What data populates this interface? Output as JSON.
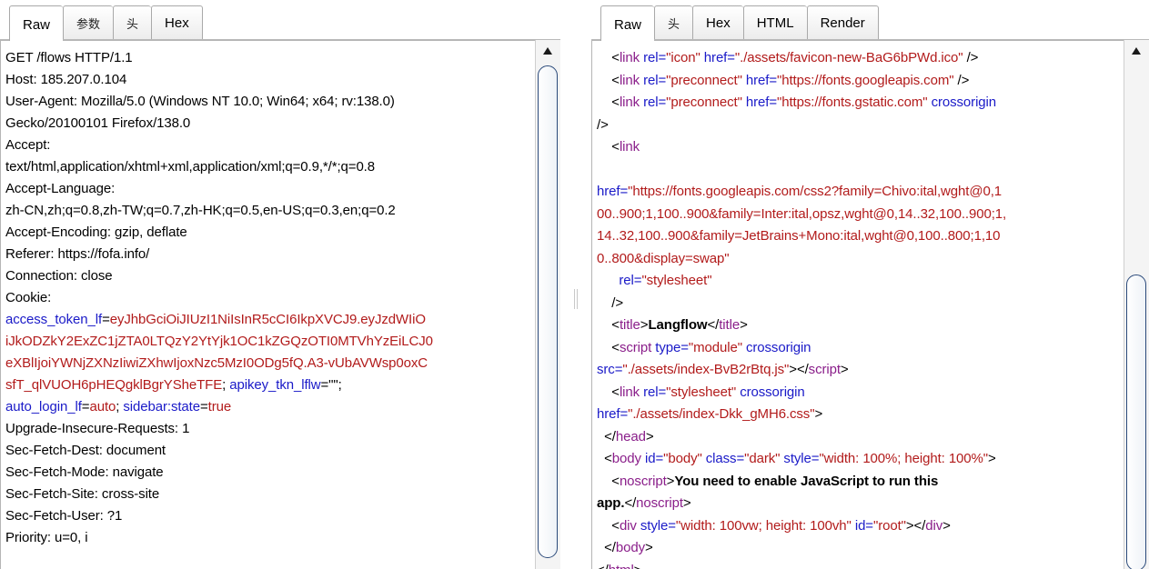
{
  "request": {
    "tabs": [
      "Raw",
      "参数",
      "头",
      "Hex"
    ],
    "lines": [
      [
        [
          "GET /flows HTTP/1.1",
          "p"
        ]
      ],
      [
        [
          "Host: 185.207.0.104",
          "p"
        ]
      ],
      [
        [
          "User-Agent: Mozilla/5.0 (Windows NT 10.0; Win64; x64; rv:138.0)",
          "p"
        ]
      ],
      [
        [
          "Gecko/20100101 Firefox/138.0",
          "p"
        ]
      ],
      [
        [
          "Accept:",
          "p"
        ]
      ],
      [
        [
          "text/html,application/xhtml+xml,application/xml;q=0.9,*/*;q=0.8",
          "p"
        ]
      ],
      [
        [
          "Accept-Language:",
          "p"
        ]
      ],
      [
        [
          "zh-CN,zh;q=0.8,zh-TW;q=0.7,zh-HK;q=0.5,en-US;q=0.3,en;q=0.2",
          "p"
        ]
      ],
      [
        [
          "Accept-Encoding: gzip, deflate",
          "p"
        ]
      ],
      [
        [
          "Referer: https://fofa.info/",
          "p"
        ]
      ],
      [
        [
          "Connection: close",
          "p"
        ]
      ],
      [
        [
          "Cookie:",
          "p"
        ]
      ],
      [
        [
          "access_token_lf",
          "k"
        ],
        [
          "=",
          "p"
        ],
        [
          "eyJhbGciOiJIUzI1NiIsInR5cCI6IkpXVCJ9.eyJzdWIiO",
          "v"
        ]
      ],
      [
        [
          "iJkODZkY2ExZC1jZTA0LTQzY2YtYjk1OC1kZGQzOTI0MTVhYzEiLCJ0",
          "v"
        ]
      ],
      [
        [
          "eXBlIjoiYWNjZXNzIiwiZXhwIjoxNzc5MzI0ODg5fQ.A3-vUbAVWsp0oxC",
          "v"
        ]
      ],
      [
        [
          "sfT_qlVUOH6pHEQgklBgrYSheTFE",
          "v"
        ],
        [
          ";",
          "p"
        ],
        [
          " apikey_tkn_lflw",
          "k"
        ],
        [
          "=\"\";",
          "p"
        ]
      ],
      [
        [
          "auto_login_lf",
          "k"
        ],
        [
          "=",
          "p"
        ],
        [
          "auto",
          "v"
        ],
        [
          ";",
          "p"
        ],
        [
          " sidebar:state",
          "k"
        ],
        [
          "=",
          "p"
        ],
        [
          "true",
          "v"
        ]
      ],
      [
        [
          "Upgrade-Insecure-Requests: 1",
          "p"
        ]
      ],
      [
        [
          "Sec-Fetch-Dest: document",
          "p"
        ]
      ],
      [
        [
          "Sec-Fetch-Mode: navigate",
          "p"
        ]
      ],
      [
        [
          "Sec-Fetch-Site: cross-site",
          "p"
        ]
      ],
      [
        [
          "Sec-Fetch-User: ?1",
          "p"
        ]
      ],
      [
        [
          "Priority: u=0, i",
          "p"
        ]
      ]
    ]
  },
  "response": {
    "tabs": [
      "Raw",
      "头",
      "Hex",
      "HTML",
      "Render"
    ],
    "lines": [
      [
        [
          "    <",
          "p"
        ],
        [
          "link",
          "tg"
        ],
        [
          " rel=",
          "at"
        ],
        [
          "\"icon\"",
          "av"
        ],
        [
          " href=",
          "at"
        ],
        [
          "\"./assets/favicon-new-BaG6bPWd.ico\"",
          "av"
        ],
        [
          " />",
          "p"
        ]
      ],
      [
        [
          "    <",
          "p"
        ],
        [
          "link",
          "tg"
        ],
        [
          " rel=",
          "at"
        ],
        [
          "\"preconnect\"",
          "av"
        ],
        [
          " href=",
          "at"
        ],
        [
          "\"https://fonts.googleapis.com\"",
          "av"
        ],
        [
          " />",
          "p"
        ]
      ],
      [
        [
          "    <",
          "p"
        ],
        [
          "link",
          "tg"
        ],
        [
          " rel=",
          "at"
        ],
        [
          "\"preconnect\"",
          "av"
        ],
        [
          " href=",
          "at"
        ],
        [
          "\"https://fonts.gstatic.com\"",
          "av"
        ],
        [
          " crossorigin",
          "at"
        ]
      ],
      [
        [
          "/>",
          "p"
        ]
      ],
      [
        [
          "    <",
          "p"
        ],
        [
          "link",
          "tg"
        ]
      ],
      [
        [
          "",
          "p"
        ]
      ],
      [
        [
          "href=",
          "at"
        ],
        [
          "\"https://fonts.googleapis.com/css2?family=Chivo:ital,wght@0,1",
          "av"
        ]
      ],
      [
        [
          "00..900;1,100..900&family=Inter:ital,opsz,wght@0,14..32,100..900;1,",
          "av"
        ]
      ],
      [
        [
          "14..32,100..900&family=JetBrains+Mono:ital,wght@0,100..800;1,10",
          "av"
        ]
      ],
      [
        [
          "0..800&display=swap\"",
          "av"
        ]
      ],
      [
        [
          "      rel=",
          "at"
        ],
        [
          "\"stylesheet\"",
          "av"
        ]
      ],
      [
        [
          "    />",
          "p"
        ]
      ],
      [
        [
          "    <",
          "p"
        ],
        [
          "title",
          "tg"
        ],
        [
          ">",
          "p"
        ],
        [
          "Langflow",
          "b"
        ],
        [
          "</",
          "p"
        ],
        [
          "title",
          "tg"
        ],
        [
          ">",
          "p"
        ]
      ],
      [
        [
          "    <",
          "p"
        ],
        [
          "script",
          "tg"
        ],
        [
          " type=",
          "at"
        ],
        [
          "\"module\"",
          "av"
        ],
        [
          " crossorigin",
          "at"
        ]
      ],
      [
        [
          "src=",
          "at"
        ],
        [
          "\"./assets/index-BvB2rBtq.js\"",
          "av"
        ],
        [
          "></",
          "p"
        ],
        [
          "script",
          "tg"
        ],
        [
          ">",
          "p"
        ]
      ],
      [
        [
          "    <",
          "p"
        ],
        [
          "link",
          "tg"
        ],
        [
          " rel=",
          "at"
        ],
        [
          "\"stylesheet\"",
          "av"
        ],
        [
          " crossorigin",
          "at"
        ]
      ],
      [
        [
          "href=",
          "at"
        ],
        [
          "\"./assets/index-Dkk_gMH6.css\"",
          "av"
        ],
        [
          ">",
          "p"
        ]
      ],
      [
        [
          "  </",
          "p"
        ],
        [
          "head",
          "tg"
        ],
        [
          ">",
          "p"
        ]
      ],
      [
        [
          "  <",
          "p"
        ],
        [
          "body",
          "tg"
        ],
        [
          " id=",
          "at"
        ],
        [
          "\"body\"",
          "av"
        ],
        [
          " class=",
          "at"
        ],
        [
          "\"dark\"",
          "av"
        ],
        [
          " style=",
          "at"
        ],
        [
          "\"width: 100%; height: 100%\"",
          "av"
        ],
        [
          ">",
          "p"
        ]
      ],
      [
        [
          "    <",
          "p"
        ],
        [
          "noscript",
          "tg"
        ],
        [
          ">",
          "p"
        ],
        [
          "You need to enable JavaScript to run this",
          "b"
        ]
      ],
      [
        [
          "app.",
          "b"
        ],
        [
          "</",
          "p"
        ],
        [
          "noscript",
          "tg"
        ],
        [
          ">",
          "p"
        ]
      ],
      [
        [
          "    <",
          "p"
        ],
        [
          "div",
          "tg"
        ],
        [
          " style=",
          "at"
        ],
        [
          "\"width: 100vw; height: 100vh\"",
          "av"
        ],
        [
          " id=",
          "at"
        ],
        [
          "\"root\"",
          "av"
        ],
        [
          "></",
          "p"
        ],
        [
          "div",
          "tg"
        ],
        [
          ">",
          "p"
        ]
      ],
      [
        [
          "  </",
          "p"
        ],
        [
          "body",
          "tg"
        ],
        [
          ">",
          "p"
        ]
      ],
      [
        [
          "</",
          "p"
        ],
        [
          "html",
          "tg"
        ],
        [
          ">",
          "p"
        ]
      ]
    ]
  },
  "icons": {
    "scroll_up": "triangle-up-icon",
    "splitter": "splitter-grip-icon"
  },
  "colors": {
    "key": "#1a1ac8",
    "value": "#b21b1b",
    "tag": "#8a1e8a"
  }
}
